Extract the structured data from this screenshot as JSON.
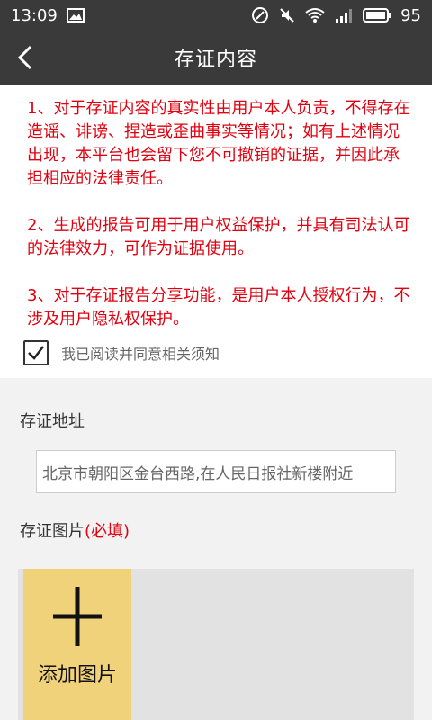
{
  "status_bar": {
    "time": "13:09",
    "battery": "95",
    "icons": [
      "image-icon",
      "nfc-icon",
      "mute-icon",
      "wifi-icon",
      "signal-3g-icon",
      "battery-icon"
    ]
  },
  "header": {
    "title": "存证内容",
    "back_icon": "chevron-left-icon"
  },
  "notice": {
    "item1": "1、对于存证内容的真实性由用户本人负责，不得存在造谣、诽谤、捏造或歪曲事实等情况；如有上述情况出现，本平台也会留下您不可撤销的证据，并因此承担相应的法律责任。",
    "item2": "2、生成的报告可用于用户权益保护，并具有司法认可的法律效力，可作为证据使用。",
    "item3": "3、对于存证报告分享功能，是用户本人授权行为，不涉及用户隐私权保护。"
  },
  "agree": {
    "label": "我已阅读并同意相关须知",
    "checked": true
  },
  "address": {
    "label": "存证地址",
    "value": "北京市朝阳区金台西路,在人民日报社新楼附近"
  },
  "images": {
    "label": "存证图片",
    "required": "(必填)",
    "add_label": "添加图片"
  },
  "colors": {
    "bar_bg": "#3a3a3a",
    "notice_text": "#e0000f",
    "add_tile": "#f0d27a",
    "section_bg": "#f2f2f2"
  }
}
